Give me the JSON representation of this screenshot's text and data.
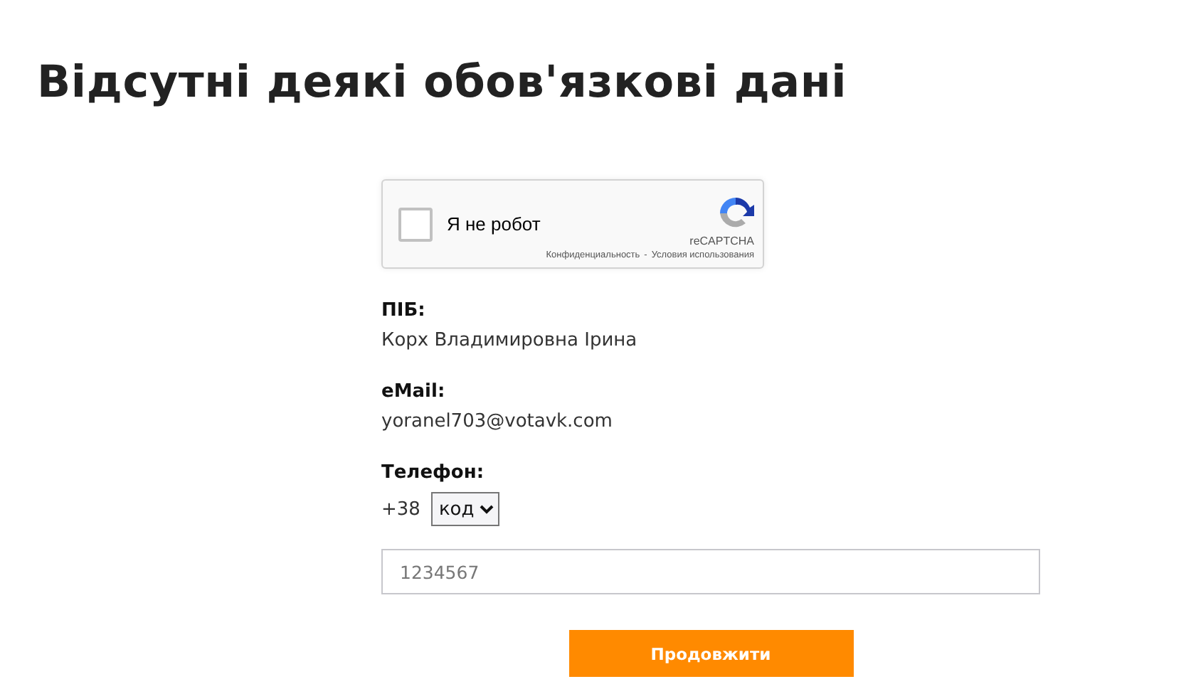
{
  "title": "Відсутні деякі обов'язкові дані",
  "captcha": {
    "label": "Я не робот",
    "checked": false,
    "brand": "reCAPTCHA",
    "links": [
      "Конфиденциальность",
      "-",
      "Условия использования"
    ]
  },
  "fields": [
    {
      "label": "ПІБ:",
      "value": "Корх Владимировна Ірина"
    },
    {
      "label": "eMail:",
      "value": "yoranel703@votavk.com"
    }
  ],
  "phone": {
    "label": "Телефон:",
    "prefix": "+38",
    "code_select": "код",
    "placeholder": "1234567"
  },
  "submit": "Продовжити"
}
